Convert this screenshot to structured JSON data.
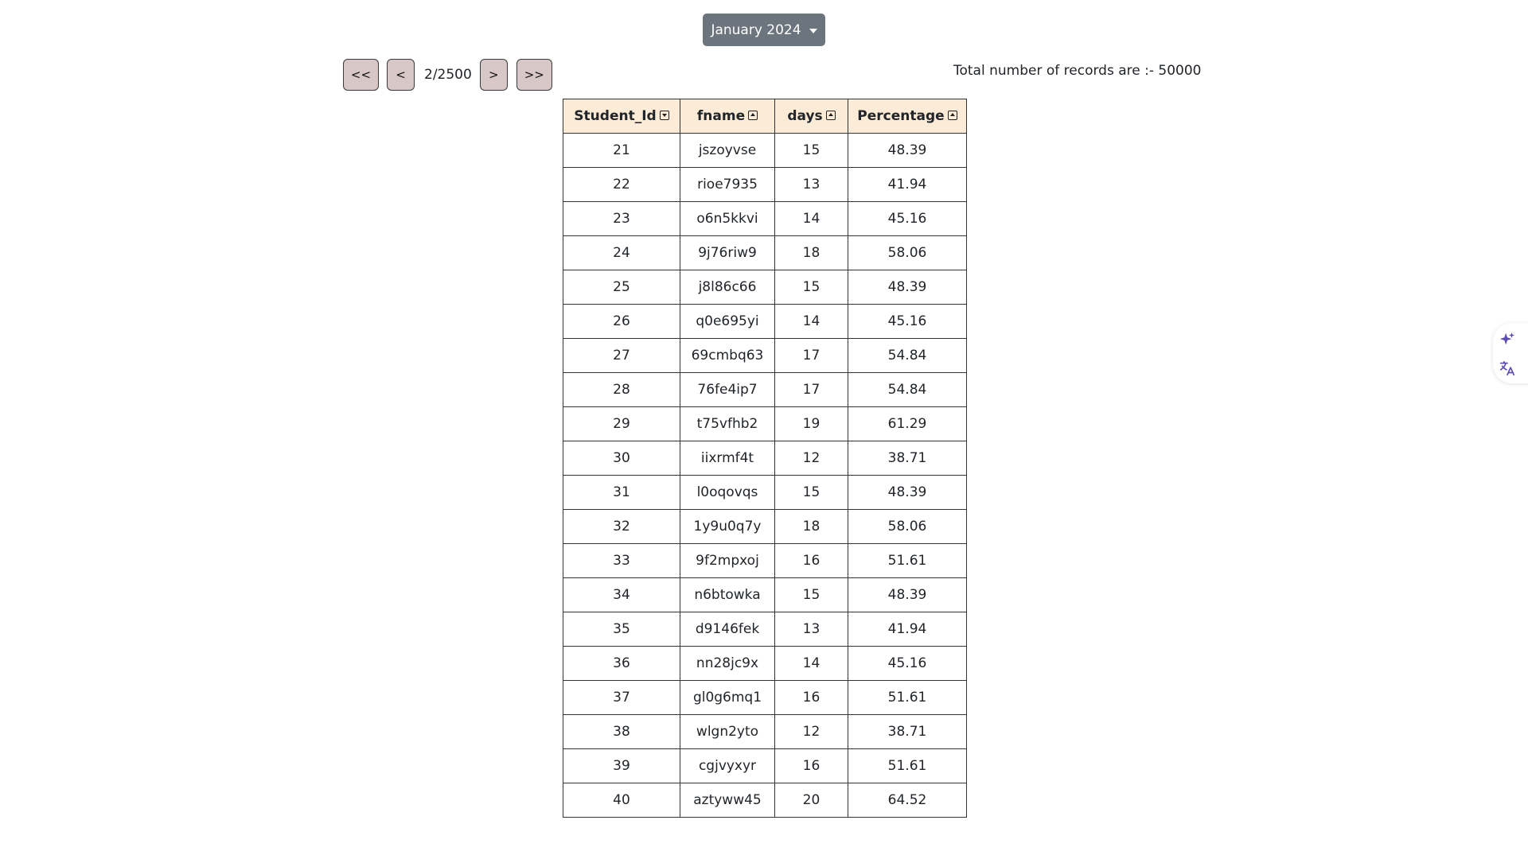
{
  "month_selector": {
    "label": "January 2024"
  },
  "pagination": {
    "first_label": "<<",
    "prev_label": "<",
    "page_info": "2/2500",
    "next_label": ">",
    "last_label": ">>"
  },
  "total_records_text": "Total number of records are :- 50000",
  "table": {
    "headers": [
      "Student_Id",
      "fname",
      "days",
      "Percentage"
    ],
    "rows": [
      [
        "21",
        "jszoyvse",
        "15",
        "48.39"
      ],
      [
        "22",
        "rioe7935",
        "13",
        "41.94"
      ],
      [
        "23",
        "o6n5kkvi",
        "14",
        "45.16"
      ],
      [
        "24",
        "9j76riw9",
        "18",
        "58.06"
      ],
      [
        "25",
        "j8l86c66",
        "15",
        "48.39"
      ],
      [
        "26",
        "q0e695yi",
        "14",
        "45.16"
      ],
      [
        "27",
        "69cmbq63",
        "17",
        "54.84"
      ],
      [
        "28",
        "76fe4ip7",
        "17",
        "54.84"
      ],
      [
        "29",
        "t75vfhb2",
        "19",
        "61.29"
      ],
      [
        "30",
        "iixrmf4t",
        "12",
        "38.71"
      ],
      [
        "31",
        "l0oqovqs",
        "15",
        "48.39"
      ],
      [
        "32",
        "1y9u0q7y",
        "18",
        "58.06"
      ],
      [
        "33",
        "9f2mpxoj",
        "16",
        "51.61"
      ],
      [
        "34",
        "n6btowka",
        "15",
        "48.39"
      ],
      [
        "35",
        "d9146fek",
        "13",
        "41.94"
      ],
      [
        "36",
        "nn28jc9x",
        "14",
        "45.16"
      ],
      [
        "37",
        "gl0g6mq1",
        "16",
        "51.61"
      ],
      [
        "38",
        "wlgn2yto",
        "12",
        "38.71"
      ],
      [
        "39",
        "cgjvyxyr",
        "16",
        "51.61"
      ],
      [
        "40",
        "aztyww45",
        "20",
        "64.52"
      ]
    ]
  },
  "side_widget": {
    "icons": [
      "sparkle-icon",
      "translate-icon"
    ],
    "accent": "#5b4bb0"
  }
}
